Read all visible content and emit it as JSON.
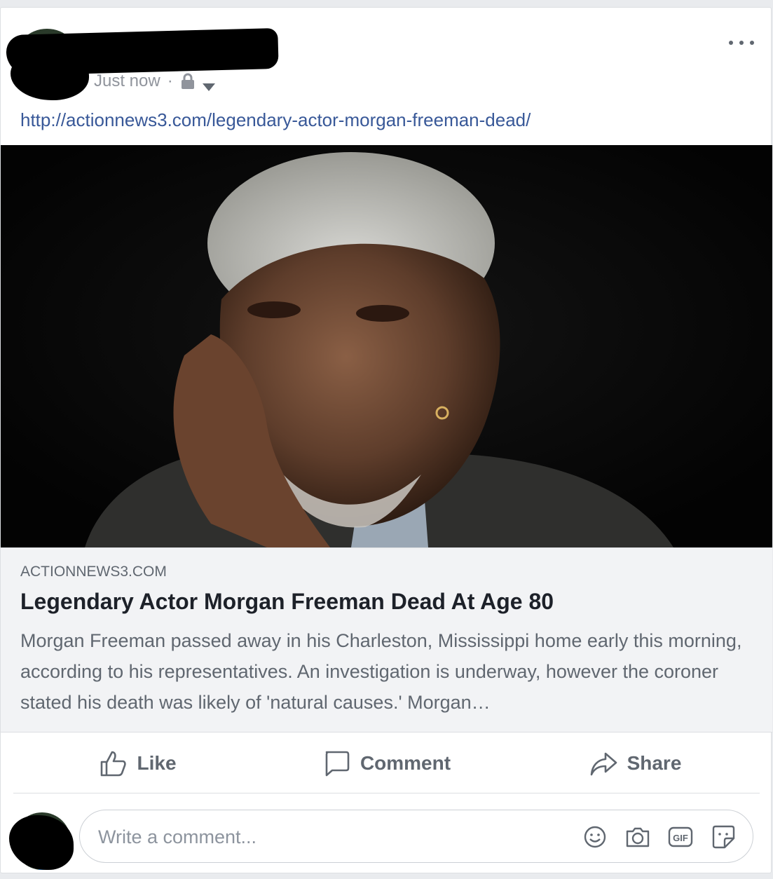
{
  "post": {
    "timestamp": "Just now",
    "separator": "·",
    "privacy_icon": "lock-icon",
    "audience_icon": "caret-down-icon",
    "more_icon": "more-options-icon",
    "link_text": "http://actionnews3.com/legendary-actor-morgan-freeman-dead/"
  },
  "preview": {
    "domain": "ACTIONNEWS3.COM",
    "title": "Legendary Actor Morgan Freeman Dead At Age 80",
    "description": "Morgan Freeman passed away in his Charleston, Mississippi home early this morning, according to his representatives. An investigation is underway, however the coroner stated his death was likely of 'natural causes.' Morgan…"
  },
  "actions": {
    "like": "Like",
    "comment": "Comment",
    "share": "Share"
  },
  "comment_box": {
    "placeholder": "Write a comment...",
    "icons": [
      "emoji-icon",
      "camera-icon",
      "gif-icon",
      "sticker-icon"
    ]
  },
  "colors": {
    "link": "#385898",
    "muted": "#606770",
    "title": "#1d2129",
    "background": "#e9ebee"
  }
}
